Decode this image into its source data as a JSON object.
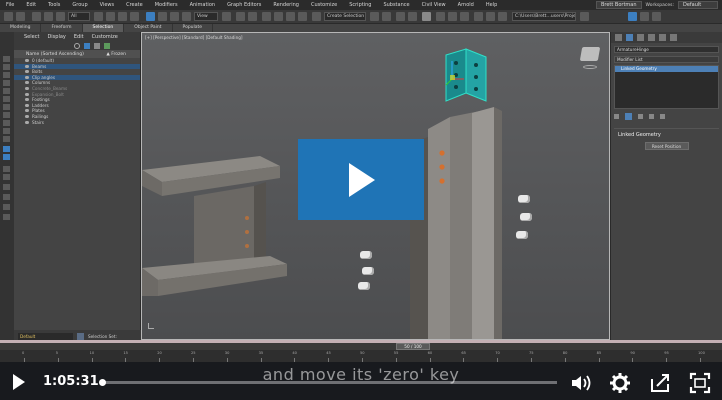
{
  "menubar": {
    "items": [
      "File",
      "Edit",
      "Tools",
      "Group",
      "Views",
      "Create",
      "Modifiers",
      "Animation",
      "Graph Editors",
      "Rendering",
      "Customize",
      "Scripting",
      "Substance",
      "Civil View",
      "Arnold",
      "Help"
    ],
    "user": "Brett Bortman",
    "workspace_label": "Workspaces:",
    "workspace_value": "Default"
  },
  "toolbar": {
    "filter_value": "All",
    "view_value": "View",
    "selection_set": "Create Selection Se",
    "project_path": "C:\\Users\\Brett…users\\Project"
  },
  "ribbon": {
    "tabs": [
      "Modeling",
      "Freeform",
      "Selection",
      "Object Paint",
      "Populate"
    ],
    "active": "Selection"
  },
  "scene_explorer": {
    "tabs": [
      "Select",
      "Display",
      "Edit",
      "Customize"
    ],
    "header_name": "Name (Sorted Ascending)",
    "header_frozen": "▲ Frozen",
    "rows": [
      {
        "label": "0 (default)",
        "selected": false,
        "dim": false
      },
      {
        "label": "Beams",
        "selected": true,
        "dim": false
      },
      {
        "label": "Bolts",
        "selected": false,
        "dim": false
      },
      {
        "label": "Clip angles",
        "selected": true,
        "dim": false
      },
      {
        "label": "Columns",
        "selected": false,
        "dim": false
      },
      {
        "label": "Concrete_Beams",
        "selected": false,
        "dim": true
      },
      {
        "label": "Expansion_Bolt",
        "selected": false,
        "dim": true
      },
      {
        "label": "Footings",
        "selected": false,
        "dim": false
      },
      {
        "label": "Ladders",
        "selected": false,
        "dim": false
      },
      {
        "label": "Plates",
        "selected": false,
        "dim": false
      },
      {
        "label": "Railings",
        "selected": false,
        "dim": false
      },
      {
        "label": "Stairs",
        "selected": false,
        "dim": false
      }
    ],
    "layer_field": "Default",
    "selection_set_label": "Selection Set:"
  },
  "viewport": {
    "label": "[+] [Perspective] [Standard] [Default Shading]"
  },
  "command_panel": {
    "object_name": "ArmatureHinge",
    "modifier_list": "Modifier List",
    "stack_item": "Linked Geometry",
    "rollout_title": "Linked Geometry",
    "rollout_button": "Reset Position"
  },
  "timeline": {
    "frame_display": "50 / 100",
    "ticks": [
      "0",
      "5",
      "10",
      "15",
      "20",
      "25",
      "30",
      "35",
      "40",
      "45",
      "50",
      "55",
      "60",
      "65",
      "70",
      "75",
      "80",
      "85",
      "90",
      "95",
      "100"
    ]
  },
  "player": {
    "timestamp": "1:05:31",
    "caption": "and move its 'zero' key",
    "progress_fraction": 0.005,
    "accent": "#1f74b6"
  }
}
